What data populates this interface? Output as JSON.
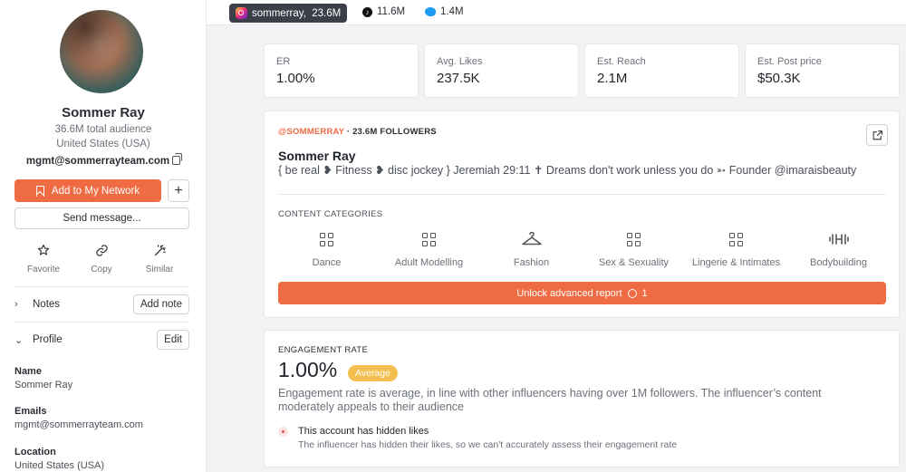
{
  "profile": {
    "name": "Sommer Ray",
    "audience": "36.6M total audience",
    "country": "United States (USA)",
    "email": "mgmt@sommerrayteam.com",
    "add_network_label": "Add to My Network",
    "plus_label": "+",
    "send_message_label": "Send message...",
    "actions": [
      {
        "label": "Favorite",
        "icon": "star-icon"
      },
      {
        "label": "Copy",
        "icon": "link-icon"
      },
      {
        "label": "Similar",
        "icon": "magic-wand-icon"
      }
    ],
    "notes_title": "Notes",
    "add_note_label": "Add note",
    "profile_title": "Profile",
    "edit_label": "Edit",
    "fields": [
      {
        "label": "Name",
        "value": "Sommer Ray"
      },
      {
        "label": "Emails",
        "value": "mgmt@sommerrayteam.com"
      },
      {
        "label": "Location",
        "value": "United States (USA)"
      }
    ]
  },
  "topbar": {
    "instagram": "sommerray,  23.6M",
    "tiktok": "11.6M",
    "twitter": "1.4M"
  },
  "stats": [
    {
      "label": "ER",
      "value": "1.00%"
    },
    {
      "label": "Avg. Likes",
      "value": "237.5K"
    },
    {
      "label": "Est. Reach",
      "value": "2.1M"
    },
    {
      "label": "Est. Post price",
      "value": "$50.3K"
    }
  ],
  "account": {
    "handle": "@SOMMERRAY",
    "followers": " · 23.6M FOLLOWERS",
    "name": "Sommer Ray",
    "bio": "{ be real ❥ Fitness ❥ disc jockey } Jeremiah 29:11 ✝ Dreams don't work unless you do ➳ Founder @imaraisbeauty",
    "categories_title": "CONTENT CATEGORIES",
    "categories": [
      {
        "label": "Dance",
        "icon": "grid-icon"
      },
      {
        "label": "Adult Modelling",
        "icon": "grid-icon"
      },
      {
        "label": "Fashion",
        "icon": "hanger-icon"
      },
      {
        "label": "Sex & Sexuality",
        "icon": "grid-icon"
      },
      {
        "label": "Lingerie & Intimates",
        "icon": "grid-icon"
      },
      {
        "label": "Bodybuilding",
        "icon": "dumbbell-icon"
      }
    ],
    "unlock_label": "Unlock advanced report",
    "unlock_cost": "1"
  },
  "engagement": {
    "title": "ENGAGEMENT RATE",
    "value": "1.00%",
    "badge": "Average",
    "description": "Engagement rate is average, in line with other influencers having over 1M followers. The influencer’s content moderately appeals to their audience",
    "hidden_title": "This account has hidden likes",
    "hidden_desc": "The influencer has hidden their likes, so we can't accurately assess their engagement rate"
  },
  "colors": {
    "accent": "#ef6b43",
    "badge": "#f4bf4f",
    "dark_pill": "#3b3f47"
  }
}
